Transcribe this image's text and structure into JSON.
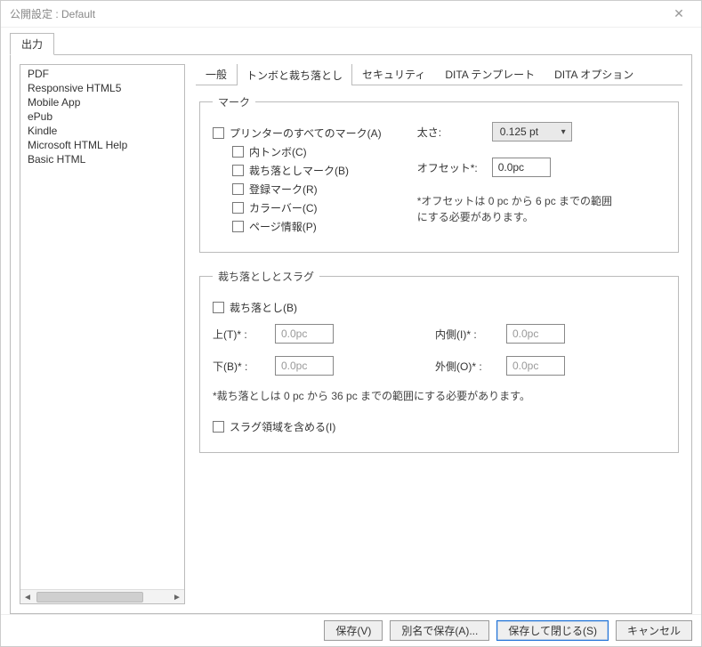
{
  "window": {
    "title": "公開設定 : Default"
  },
  "topTab": "出力",
  "leftList": [
    "PDF",
    "Responsive HTML5",
    "Mobile App",
    "ePub",
    "Kindle",
    "Microsoft HTML Help",
    "Basic HTML"
  ],
  "innerTabs": {
    "general": "一般",
    "marks": "トンボと裁ち落とし",
    "security": "セキュリティ",
    "ditaTemplate": "DITA テンプレート",
    "ditaOptions": "DITA オプション"
  },
  "marksGroup": {
    "legend": "マーク",
    "allMarks": "プリンターのすべてのマーク(A)",
    "innerTrim": "内トンボ(C)",
    "bleedMarks": "裁ち落としマーク(B)",
    "regMarks": "登録マーク(R)",
    "colorBar": "カラーバー(C)",
    "pageInfo": "ページ情報(P)",
    "thicknessLabel": "太さ:",
    "thicknessValue": "0.125 pt",
    "offsetLabel": "オフセット*:",
    "offsetValue": "0.0pc",
    "offsetNote": "*オフセットは 0 pc から 6 pc までの範囲にする必要があります。"
  },
  "bleedGroup": {
    "legend": "裁ち落としとスラグ",
    "bleedCheck": "裁ち落とし(B)",
    "topLabel": "上(T)* :",
    "bottomLabel": "下(B)* :",
    "insideLabel": "内側(I)* :",
    "outsideLabel": "外側(O)* :",
    "value": "0.0pc",
    "hint": "*裁ち落としは 0 pc から 36 pc までの範囲にする必要があります。",
    "slugCheck": "スラグ領域を含める(I)"
  },
  "buttons": {
    "save": "保存(V)",
    "saveAs": "別名で保存(A)...",
    "saveClose": "保存して閉じる(S)",
    "cancel": "キャンセル"
  }
}
